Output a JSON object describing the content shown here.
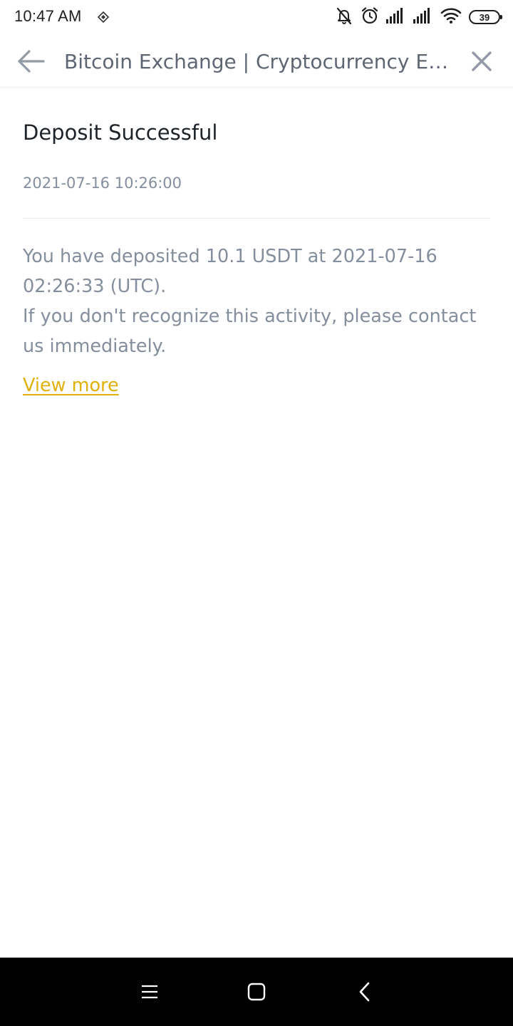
{
  "status_bar": {
    "time": "10:47 AM",
    "battery_level": "39",
    "icons": [
      "binance-notification-icon",
      "mute-icon",
      "alarm-icon",
      "signal-icon",
      "signal-icon",
      "wifi-icon",
      "battery-icon"
    ]
  },
  "header": {
    "title": "Bitcoin Exchange | Cryptocurrency Exc...",
    "back_icon": "arrow-left-icon",
    "close_icon": "close-icon"
  },
  "message": {
    "title": "Deposit Successful",
    "date": "2021-07-16 10:26:00",
    "body_line1": "You have deposited 10.1 USDT at 2021-07-16 02:26:33 (UTC).",
    "body_line2": "If you don't recognize this activity, please contact us immediately.",
    "link": "View more"
  },
  "nav_bar": {
    "buttons": [
      "menu-icon",
      "home-icon",
      "back-icon"
    ]
  },
  "colors": {
    "accent": "#e0b10a",
    "title_text": "#1e2329",
    "secondary_text": "#848e9c",
    "header_text": "#5e6673",
    "nav_bar": "#000000"
  }
}
